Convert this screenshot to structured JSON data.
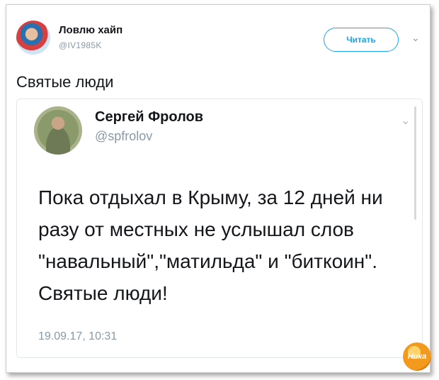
{
  "outer": {
    "name": "Ловлю хайп",
    "handle": "@IV1985K",
    "follow_label": "Читать",
    "text": "Святые люди"
  },
  "quoted": {
    "name": "Сергей Фролов",
    "handle": "@spfrolov",
    "text": "Пока отдыхал в Крыму, за 12 дней ни разу от местных не услышал слов \"навальный\",\"матильда\" и \"биткоин\". Святые люди!",
    "timestamp": "19.09.17, 10:31"
  },
  "watermark": {
    "text": "Ника"
  },
  "colors": {
    "accent": "#1da1f2",
    "muted": "#8899a6",
    "text": "#14171a"
  },
  "icons": {
    "menu": "chevron-down-icon"
  }
}
